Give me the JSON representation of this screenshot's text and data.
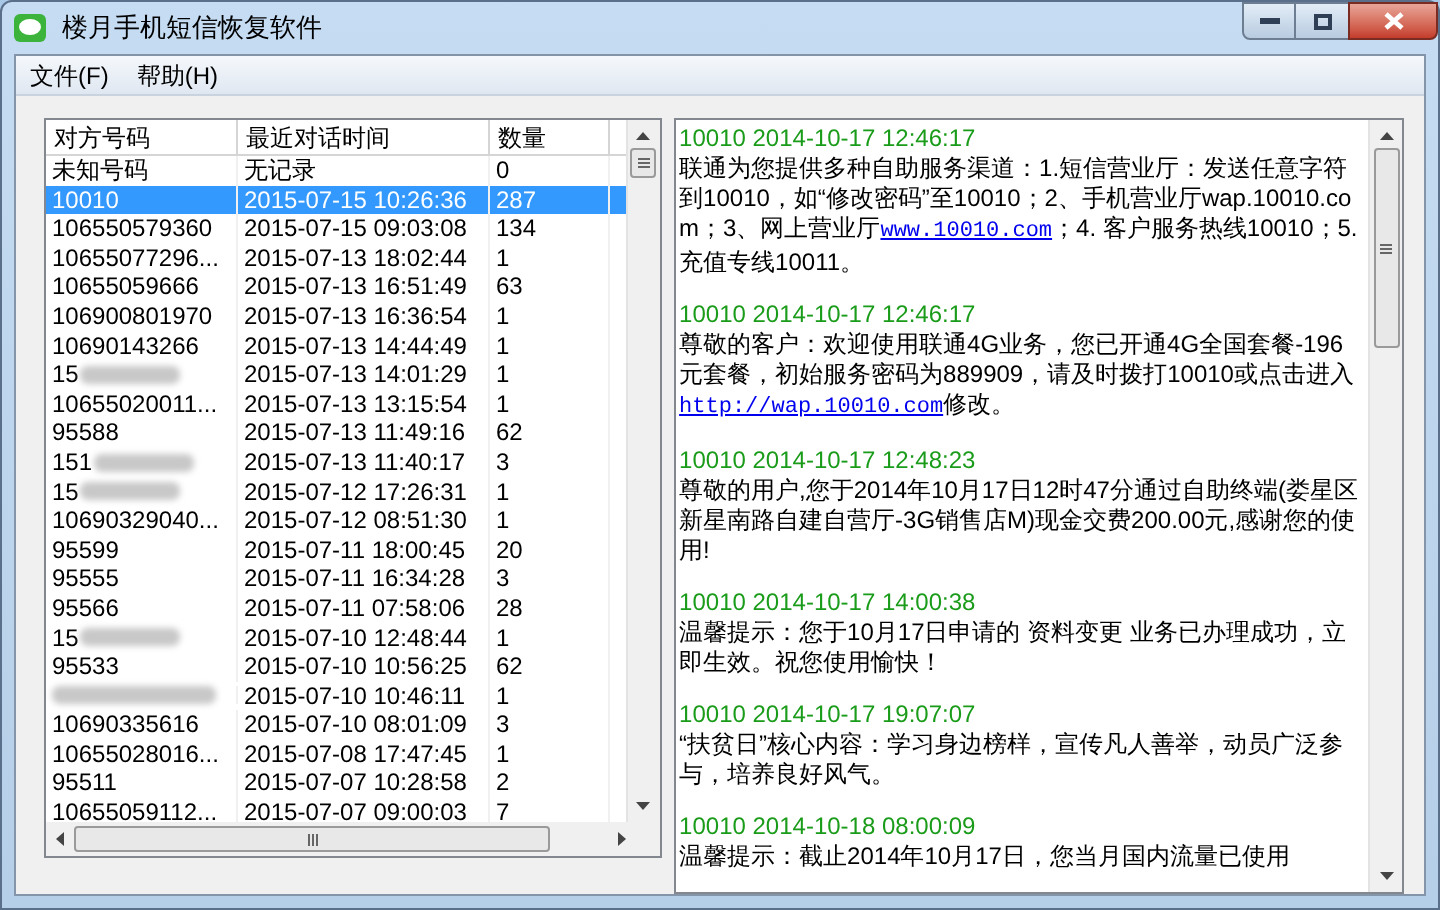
{
  "window": {
    "title": "楼月手机短信恢复软件"
  },
  "menu": [
    "文件(F)",
    "帮助(H)"
  ],
  "table": {
    "columns": [
      "对方号码",
      "最近对话时间",
      "数量"
    ],
    "rows": [
      {
        "number": "未知号码",
        "time": "无记录",
        "count": "0",
        "selected": false,
        "blurred": false
      },
      {
        "number": "10010",
        "time": "2015-07-15 10:26:36",
        "count": "287",
        "selected": true,
        "blurred": false
      },
      {
        "number": "106550579360",
        "time": "2015-07-15 09:03:08",
        "count": "134",
        "selected": false,
        "blurred": false
      },
      {
        "number": "10655077296...",
        "time": "2015-07-13 18:02:44",
        "count": "1",
        "selected": false,
        "blurred": false
      },
      {
        "number": "10655059666",
        "time": "2015-07-13 16:51:49",
        "count": "63",
        "selected": false,
        "blurred": false
      },
      {
        "number": "106900801970",
        "time": "2015-07-13 16:36:54",
        "count": "1",
        "selected": false,
        "blurred": false
      },
      {
        "number": "10690143266",
        "time": "2015-07-13 14:44:49",
        "count": "1",
        "selected": false,
        "blurred": false
      },
      {
        "number": "15",
        "time": "2015-07-13 14:01:29",
        "count": "1",
        "selected": false,
        "blurred": true
      },
      {
        "number": "10655020011...",
        "time": "2015-07-13 13:15:54",
        "count": "1",
        "selected": false,
        "blurred": false
      },
      {
        "number": "95588",
        "time": "2015-07-13 11:49:16",
        "count": "62",
        "selected": false,
        "blurred": false
      },
      {
        "number": "151",
        "time": "2015-07-13 11:40:17",
        "count": "3",
        "selected": false,
        "blurred": true
      },
      {
        "number": "15",
        "time": "2015-07-12 17:26:31",
        "count": "1",
        "selected": false,
        "blurred": true
      },
      {
        "number": "10690329040...",
        "time": "2015-07-12 08:51:30",
        "count": "1",
        "selected": false,
        "blurred": false
      },
      {
        "number": "95599",
        "time": "2015-07-11 18:00:45",
        "count": "20",
        "selected": false,
        "blurred": false
      },
      {
        "number": "95555",
        "time": "2015-07-11 16:34:28",
        "count": "3",
        "selected": false,
        "blurred": false
      },
      {
        "number": "95566",
        "time": "2015-07-11 07:58:06",
        "count": "28",
        "selected": false,
        "blurred": false
      },
      {
        "number": "15",
        "time": "2015-07-10 12:48:44",
        "count": "1",
        "selected": false,
        "blurred": true
      },
      {
        "number": "95533",
        "time": "2015-07-10 10:56:25",
        "count": "62",
        "selected": false,
        "blurred": false
      },
      {
        "time": "2015-07-10 10:46:11",
        "count": "1",
        "selected": false,
        "blurred": true
      },
      {
        "number": "10690335616",
        "time": "2015-07-10 08:01:09",
        "count": "3",
        "selected": false,
        "blurred": false
      },
      {
        "number": "10655028016...",
        "time": "2015-07-08 17:47:45",
        "count": "1",
        "selected": false,
        "blurred": false
      },
      {
        "number": "95511",
        "time": "2015-07-07 10:28:58",
        "count": "2",
        "selected": false,
        "blurred": false
      },
      {
        "number": "10655059112...",
        "time": "2015-07-07 09:00:03",
        "count": "7",
        "selected": false,
        "blurred": false
      }
    ]
  },
  "messages": [
    {
      "header": "10010 2014-10-17 12:46:17",
      "body": [
        {
          "kind": "text",
          "text": "联通为您提供多种自助服务渠道：1.短信营业厅：发送任意字符到10010，如“修改密码”至10010；2、手机营业厅wap.10010.com；3、网上营业厅"
        },
        {
          "kind": "link",
          "text": "www.10010.com"
        },
        {
          "kind": "text",
          "text": "；4. 客户服务热线10010；5.充值专线10011。"
        }
      ]
    },
    {
      "header": "10010 2014-10-17 12:46:17",
      "body": [
        {
          "kind": "text",
          "text": "尊敬的客户：欢迎使用联通4G业务，您已开通4G全国套餐-196元套餐，初始服务密码为889909，请及时拨打10010或点击进入"
        },
        {
          "kind": "link",
          "text": "http://wap.10010.com"
        },
        {
          "kind": "text",
          "text": "修改。"
        }
      ]
    },
    {
      "header": "10010 2014-10-17 12:48:23",
      "body": [
        {
          "kind": "text",
          "text": "尊敬的用户,您于2014年10月17日12时47分通过自助终端(娄星区新星南路自建自营厅-3G销售店M)现金交费200.00元,感谢您的使用!"
        }
      ]
    },
    {
      "header": "10010 2014-10-17 14:00:38",
      "body": [
        {
          "kind": "text",
          "text": "温馨提示：您于10月17日申请的 资料变更 业务已办理成功，立即生效。祝您使用愉快！"
        }
      ]
    },
    {
      "header": "10010 2014-10-17 19:07:07",
      "body": [
        {
          "kind": "text",
          "text": "“扶贫日”核心内容：学习身边榜样，宣传凡人善举，动员广泛参与，培养良好风气。"
        }
      ]
    },
    {
      "header": "10010 2014-10-18 08:00:09",
      "body": [
        {
          "kind": "text",
          "text": "温馨提示：截止2014年10月17日，您当月国内流量已使用"
        }
      ]
    }
  ]
}
